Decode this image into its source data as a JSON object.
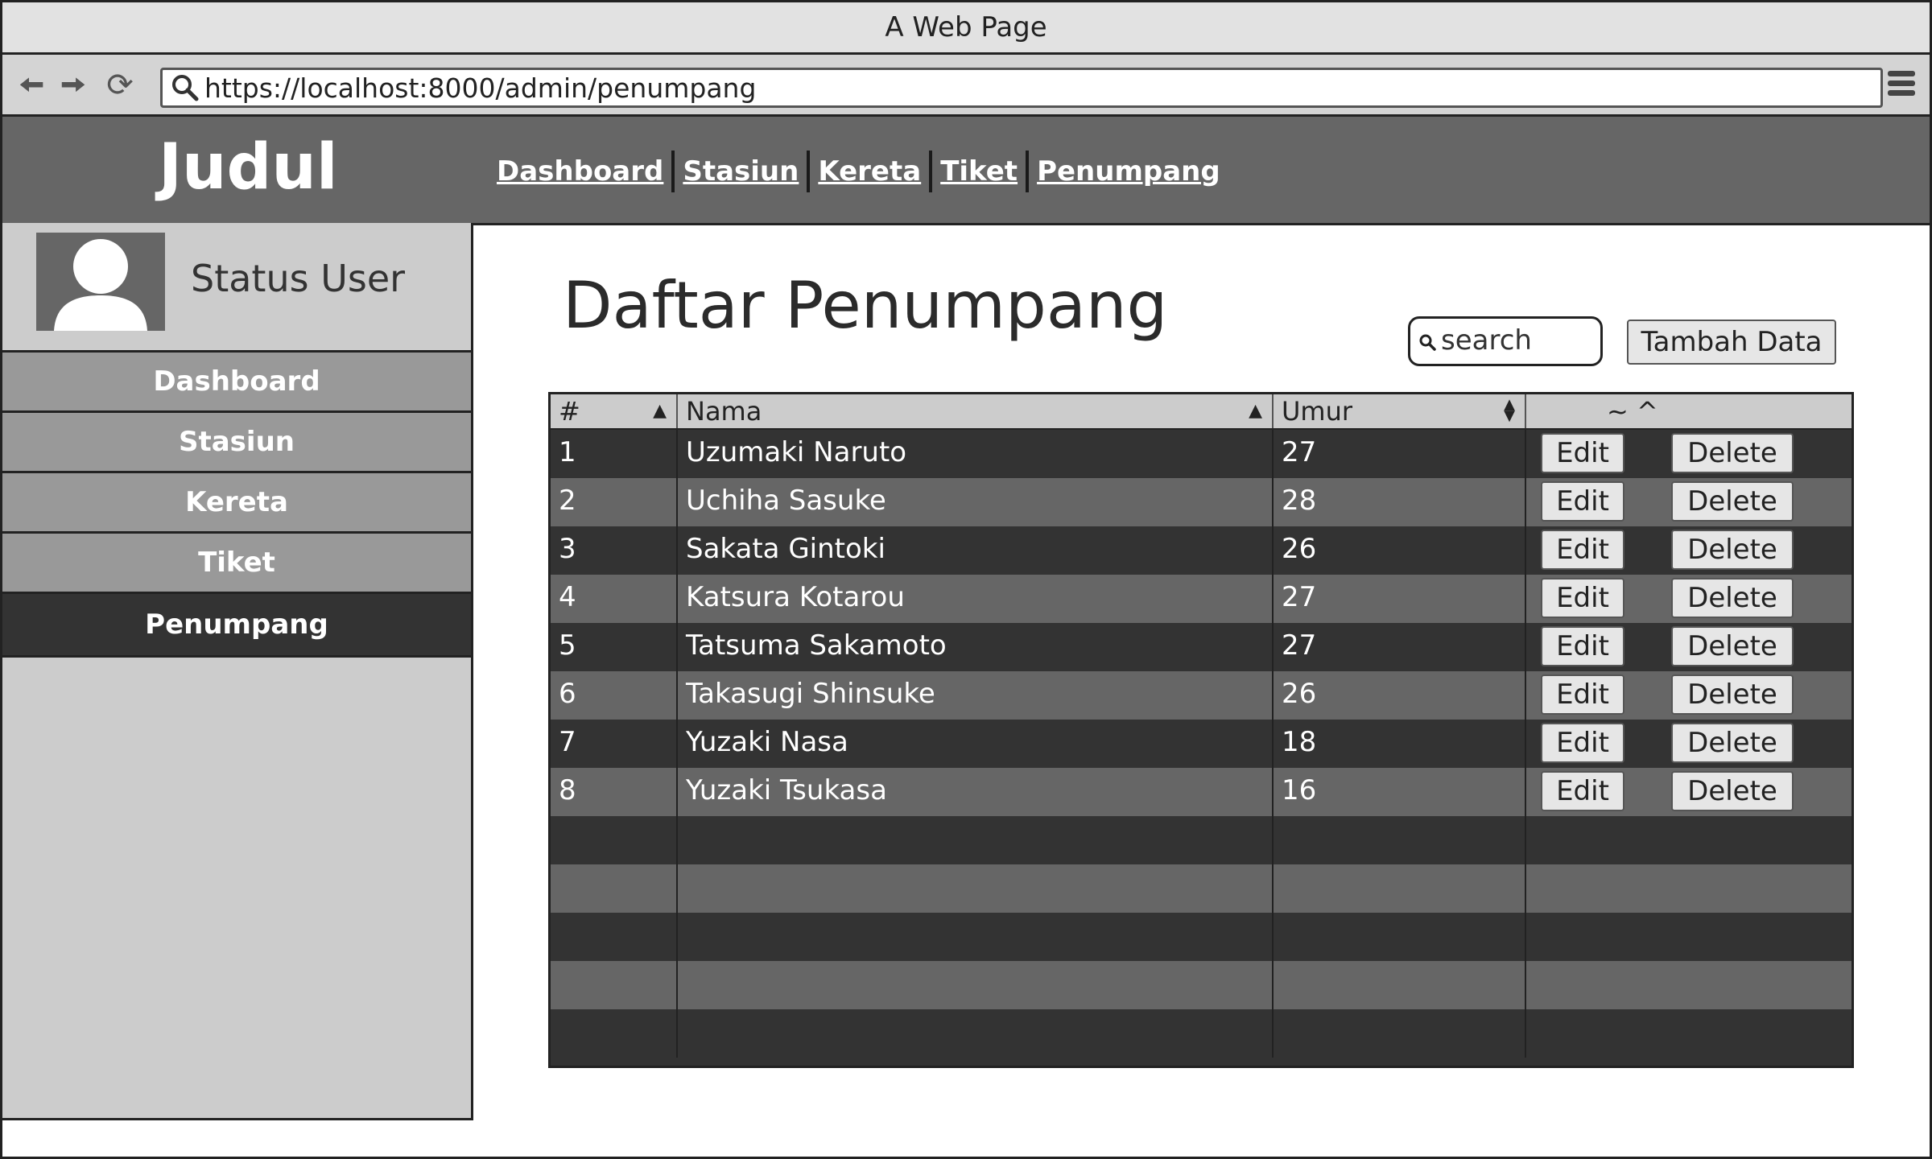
{
  "window": {
    "title": "A Web Page"
  },
  "browser": {
    "url": "https://localhost:8000/admin/penumpang"
  },
  "header": {
    "brand": "Judul",
    "nav": [
      "Dashboard",
      "Stasiun",
      "Kereta",
      "Tiket",
      "Penumpang"
    ]
  },
  "sidebar": {
    "user_status": "Status User",
    "items": [
      {
        "label": "Dashboard",
        "active": false
      },
      {
        "label": "Stasiun",
        "active": false
      },
      {
        "label": "Kereta",
        "active": false
      },
      {
        "label": "Tiket",
        "active": false
      },
      {
        "label": "Penumpang",
        "active": true
      }
    ]
  },
  "main": {
    "title": "Daftar Penumpang",
    "search_placeholder": "search",
    "add_button": "Tambah Data",
    "table": {
      "headers": [
        "#",
        "Nama",
        "Umur",
        "~ ^"
      ],
      "rows": [
        {
          "no": "1",
          "nama": "Uzumaki Naruto",
          "umur": "27"
        },
        {
          "no": "2",
          "nama": "Uchiha Sasuke",
          "umur": "28"
        },
        {
          "no": "3",
          "nama": "Sakata Gintoki",
          "umur": "26"
        },
        {
          "no": "4",
          "nama": "Katsura Kotarou",
          "umur": "27"
        },
        {
          "no": "5",
          "nama": "Tatsuma Sakamoto",
          "umur": "27"
        },
        {
          "no": "6",
          "nama": "Takasugi Shinsuke",
          "umur": "26"
        },
        {
          "no": "7",
          "nama": "Yuzaki Nasa",
          "umur": "18"
        },
        {
          "no": "8",
          "nama": "Yuzaki Tsukasa",
          "umur": "16"
        }
      ],
      "edit_label": "Edit",
      "delete_label": "Delete"
    }
  },
  "colors": {
    "header": "#666666",
    "sidebar": "#cccccc",
    "sidebar_item": "#999999",
    "active": "#333333"
  }
}
